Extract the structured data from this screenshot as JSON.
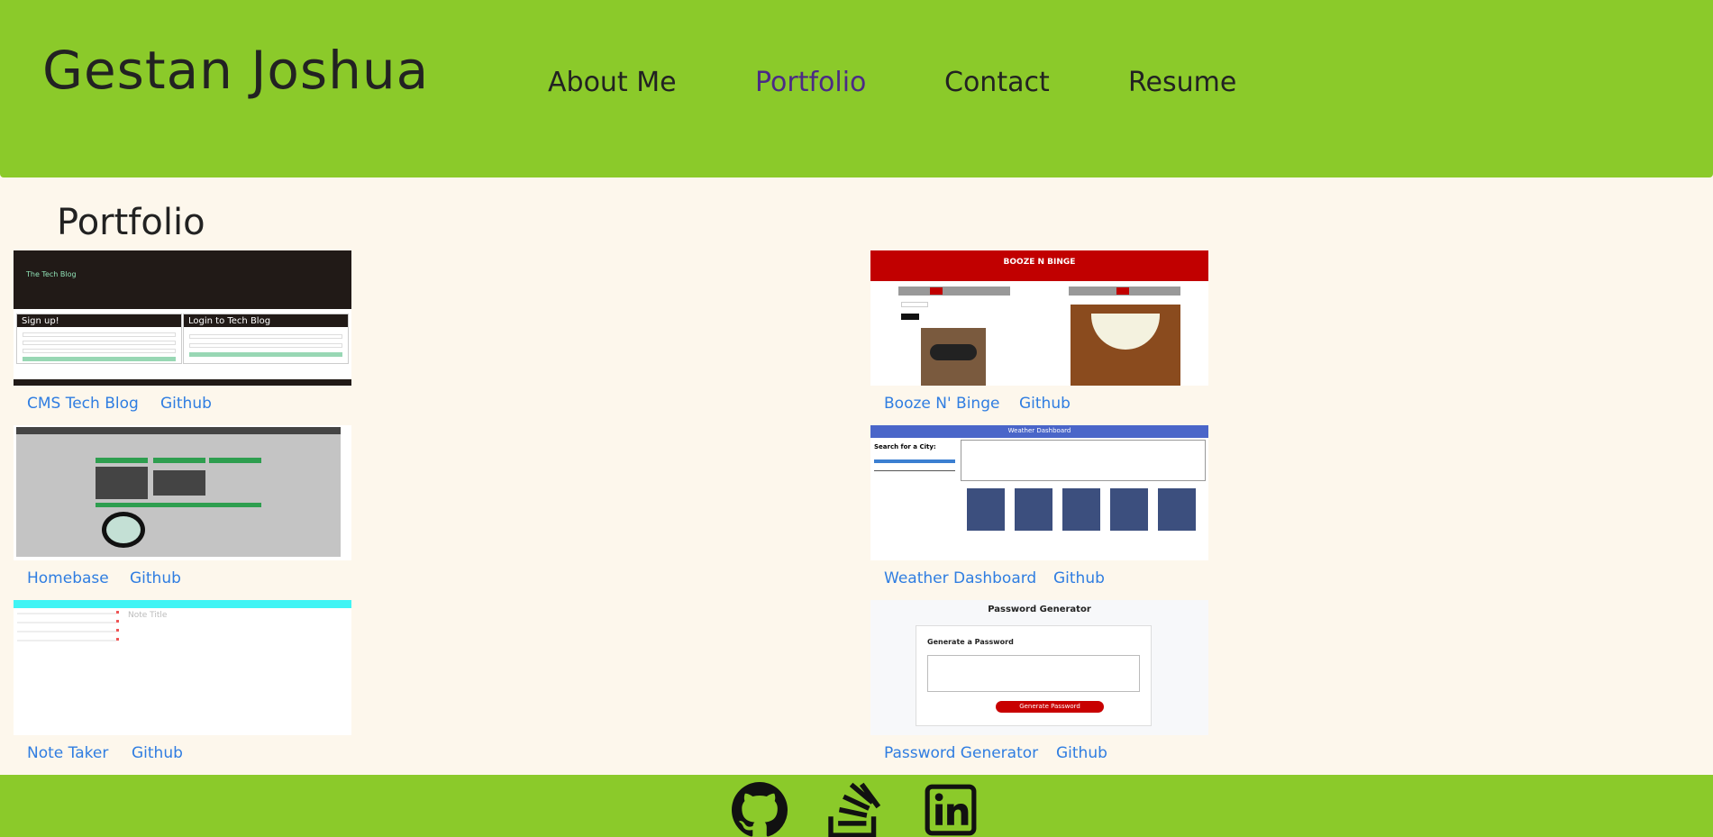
{
  "header": {
    "title": "Gestan Joshua",
    "nav": [
      {
        "label": "About Me"
      },
      {
        "label": "Portfolio"
      },
      {
        "label": "Contact"
      },
      {
        "label": "Resume"
      }
    ]
  },
  "section": {
    "title": "Portfolio"
  },
  "projects": [
    {
      "name": "CMS Tech Blog",
      "github": "Github",
      "thumb_title": "The Tech Blog",
      "thumb_a": "Sign up!",
      "thumb_b": "Login to Tech Blog"
    },
    {
      "name": "Booze N' Binge",
      "github": "Github",
      "thumb_title": "BOOZE N BINGE"
    },
    {
      "name": "Homebase",
      "github": "Github"
    },
    {
      "name": "Weather Dashboard",
      "github": "Github",
      "thumb_title": "Weather Dashboard",
      "thumb_a": "Search for a City:"
    },
    {
      "name": "Note Taker",
      "github": "Github",
      "thumb_a": "Note Title"
    },
    {
      "name": "Password Generator",
      "github": "Github",
      "thumb_title": "Password Generator",
      "thumb_a": "Generate a Password",
      "thumb_b": "Generate Password"
    }
  ],
  "footer": {
    "icons": [
      "github-icon",
      "stackoverflow-icon",
      "linkedin-icon"
    ]
  },
  "colors": {
    "header_bg": "#8bca2a",
    "page_bg": "#fdf7ec",
    "link": "#2f7de1",
    "nav_active": "#4b2a86"
  }
}
